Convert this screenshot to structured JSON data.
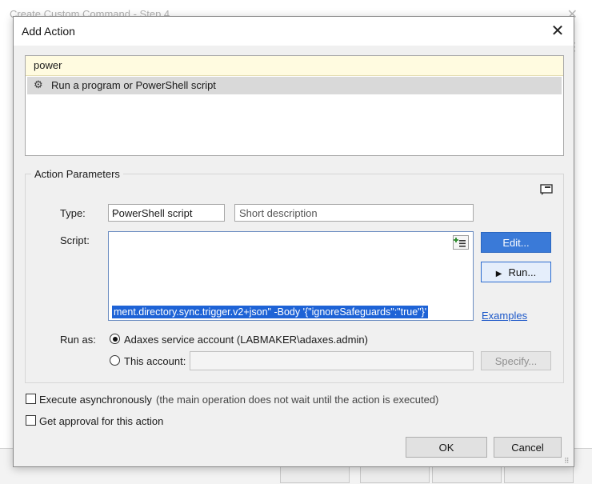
{
  "background_window": {
    "title": "Create Custom Command - Step 4"
  },
  "dialog": {
    "title": "Add Action",
    "search_value": "power",
    "results": [
      {
        "label": "Run a program or PowerShell script"
      }
    ],
    "parameters_group_label": "Action Parameters",
    "type_label": "Type:",
    "type_value": "PowerShell script",
    "description_placeholder": "Short description",
    "script_label": "Script:",
    "script_visible_text": "ment.directory.sync.trigger.v2+json\" -Body '{\"ignoreSafeguards\":\"true\"}'",
    "edit_button": "Edit...",
    "run_button": "Run...",
    "examples_link": "Examples",
    "run_as_label": "Run as:",
    "service_account_option": "Adaxes service account (LABMAKER\\adaxes.admin)",
    "this_account_option": "This account:",
    "specify_button": "Specify...",
    "execute_async_label": "Execute asynchronously",
    "execute_async_note": "(the main operation does not wait until the action is executed)",
    "approval_label": "Get approval for this action",
    "ok_button": "OK",
    "cancel_button": "Cancel"
  }
}
